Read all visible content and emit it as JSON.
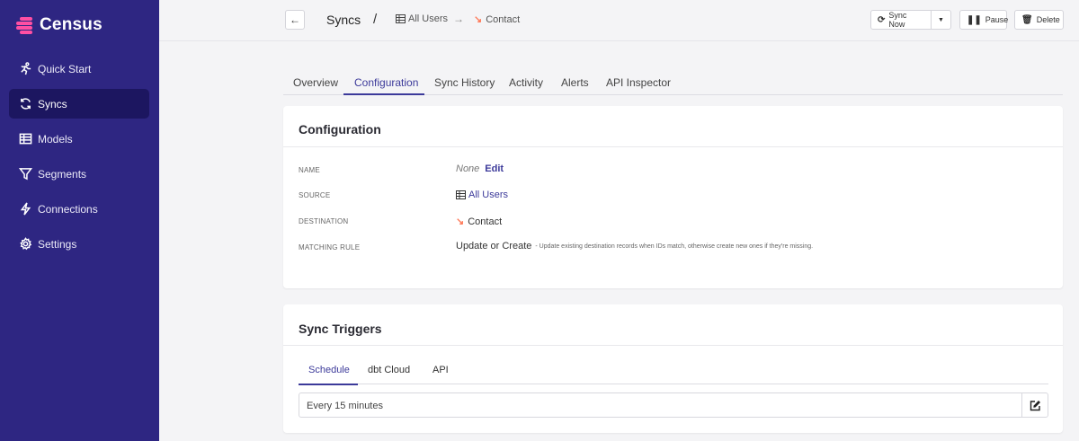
{
  "app": {
    "name": "Census"
  },
  "sidebar": {
    "items": [
      {
        "label": "Quick Start",
        "icon": "run-icon"
      },
      {
        "label": "Syncs",
        "icon": "sync-icon",
        "active": true
      },
      {
        "label": "Models",
        "icon": "table-icon"
      },
      {
        "label": "Segments",
        "icon": "filter-icon"
      },
      {
        "label": "Connections",
        "icon": "bolt-icon"
      },
      {
        "label": "Settings",
        "icon": "gear-icon"
      }
    ]
  },
  "header": {
    "title": "Syncs",
    "separator": "/",
    "source": "All Users",
    "arrow": "→",
    "destination": "Contact",
    "sync_now": "Sync Now",
    "pause": "Pause",
    "delete": "Delete"
  },
  "tabs": [
    "Overview",
    "Configuration",
    "Sync History",
    "Activity",
    "Alerts",
    "API Inspector"
  ],
  "configuration": {
    "title": "Configuration",
    "name_label": "NAME",
    "name_value": "None",
    "edit": "Edit",
    "source_label": "SOURCE",
    "source_value": "All Users",
    "destination_label": "DESTINATION",
    "destination_value": "Contact",
    "matching_label": "MATCHING RULE",
    "matching_value": "Update or Create",
    "matching_desc": "- Update existing destination records when IDs match, otherwise create new ones if they're missing."
  },
  "triggers": {
    "title": "Sync Triggers",
    "tabs": [
      "Schedule",
      "dbt Cloud",
      "API"
    ],
    "schedule_value": "Every 15 minutes"
  },
  "colors": {
    "sidebar": "#2e2682",
    "accent": "#3c3a9a",
    "brand_pink": "#ff4fa3",
    "hubspot": "#ff7a59"
  }
}
